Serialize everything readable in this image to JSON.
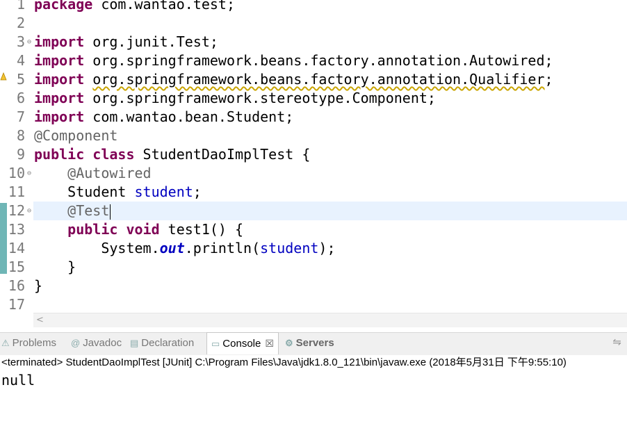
{
  "editor": {
    "current_line": 12,
    "lines": [
      {
        "n": "1",
        "fold": false,
        "html": "<span class=\"kw\">package</span> com.wantao.test;"
      },
      {
        "n": "2",
        "fold": false,
        "html": ""
      },
      {
        "n": "3",
        "fold": true,
        "html": "<span class=\"kw\">import</span> org.junit.Test;"
      },
      {
        "n": "4",
        "fold": false,
        "html": "<span class=\"kw\">import</span> org.springframework.beans.factory.annotation.Autowired;"
      },
      {
        "n": "5",
        "fold": false,
        "html": "<span class=\"kw\">import</span> <span class=\"warn\">org.springframework.beans.factory.annotation.Qualifier</span>;"
      },
      {
        "n": "6",
        "fold": false,
        "html": "<span class=\"kw\">import</span> org.springframework.stereotype.Component;"
      },
      {
        "n": "7",
        "fold": false,
        "html": "<span class=\"kw\">import</span> com.wantao.bean.Student;"
      },
      {
        "n": "8",
        "fold": false,
        "html": "<span class=\"ann\">@Component</span>"
      },
      {
        "n": "9",
        "fold": false,
        "html": "<span class=\"kw\">public</span> <span class=\"kw\">class</span> StudentDaoImplTest {"
      },
      {
        "n": "10",
        "fold": true,
        "html": "    <span class=\"ann\">@Autowired</span>"
      },
      {
        "n": "11",
        "fold": false,
        "html": "    Student <span class=\"fld\">student</span>;"
      },
      {
        "n": "12",
        "fold": true,
        "html": "    <span class=\"ann\">@Test</span><span class=\"caret\"></span>"
      },
      {
        "n": "13",
        "fold": false,
        "html": "    <span class=\"kw\">public</span> <span class=\"kw\">void</span> test1() {"
      },
      {
        "n": "14",
        "fold": false,
        "html": "        System.<span class=\"static\">out</span>.println(<span class=\"fld\">student</span>);"
      },
      {
        "n": "15",
        "fold": false,
        "html": "    }"
      },
      {
        "n": "16",
        "fold": false,
        "html": "}"
      },
      {
        "n": "17",
        "fold": false,
        "html": ""
      }
    ]
  },
  "tabs": [
    {
      "label": "Problems",
      "icon": "problems-icon",
      "glyph": "⚠",
      "active": false
    },
    {
      "label": "Javadoc",
      "icon": "javadoc-icon",
      "glyph": "@",
      "active": false
    },
    {
      "label": "Declaration",
      "icon": "declaration-icon",
      "glyph": "▤",
      "active": false
    },
    {
      "label": "Console",
      "icon": "console-icon",
      "glyph": "▭",
      "active": true
    },
    {
      "label": "Servers",
      "icon": "servers-icon",
      "glyph": "⚙",
      "active": false
    }
  ],
  "console": {
    "terminated_line": "<terminated> StudentDaoImplTest [JUnit] C:\\Program Files\\Java\\jdk1.8.0_121\\bin\\javaw.exe (2018年5月31日 下午9:55:10)",
    "output": "null"
  },
  "colors": {
    "keyword": "#7f0055",
    "annotation": "#646464",
    "field": "#0000c0",
    "current_line": "#e8f2fe"
  }
}
